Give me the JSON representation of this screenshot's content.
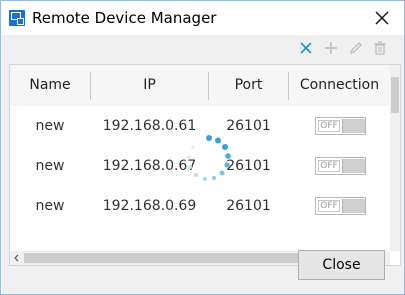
{
  "window": {
    "title": "Remote Device Manager",
    "app_icon": "remote-device-app-icon",
    "close_icon": "close-icon"
  },
  "toolbar": {
    "icons": [
      "clear-x-icon",
      "add-icon",
      "edit-pencil-icon",
      "delete-trash-icon"
    ],
    "accent": "#1e8fcf",
    "disabled_color": "#bdbdbd"
  },
  "table": {
    "columns": [
      "Name",
      "IP",
      "Port",
      "Connection"
    ],
    "rows": [
      {
        "name": "new",
        "ip": "192.168.0.61",
        "port": "26101",
        "connection": "OFF"
      },
      {
        "name": "new",
        "ip": "192.168.0.67",
        "port": "26101",
        "connection": "OFF"
      },
      {
        "name": "new",
        "ip": "192.168.0.69",
        "port": "26101",
        "connection": "OFF"
      }
    ]
  },
  "loading": {
    "indicator": "loading-spinner-icon",
    "color": "#3a9fd6"
  },
  "footer": {
    "close_label": "Close"
  }
}
